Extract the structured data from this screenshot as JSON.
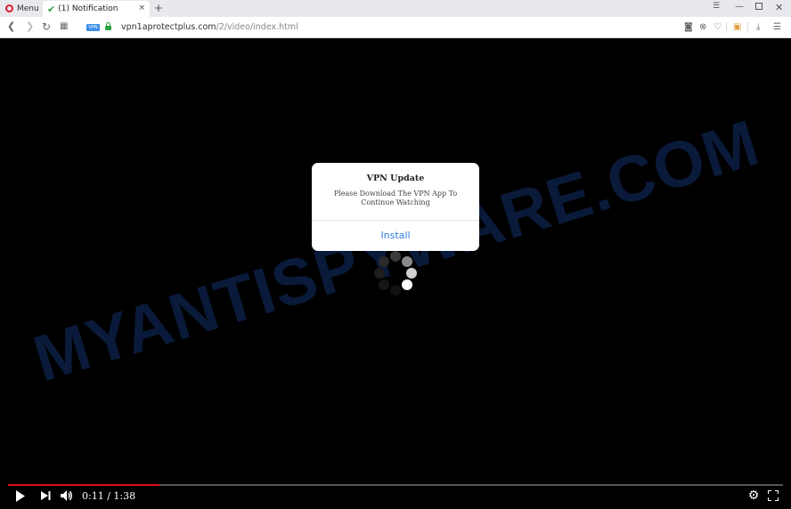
{
  "browser": {
    "menu_label": "Menu",
    "tab": {
      "title": "(1) Notification",
      "close": "×"
    },
    "new_tab": "+",
    "address": {
      "domain": "vpn1aprotectplus.com",
      "path": "/2/video/index.html",
      "vpn_badge": "VPN"
    }
  },
  "dialog": {
    "title": "VPN Update",
    "message": "Please Download The VPN App To Continue Watching",
    "button": "Install"
  },
  "watermark": {
    "text": "MYANTISPYWARE.COM",
    "color": "#0a1a3a"
  },
  "player": {
    "current_time": "0:11",
    "duration": "1:38",
    "time_display": "0:11 / 1:38",
    "progress_fraction": 0.195,
    "progress_color": "#e01010"
  },
  "colors": {
    "accent": "#2f7ce0",
    "lock": "#2ea043"
  }
}
